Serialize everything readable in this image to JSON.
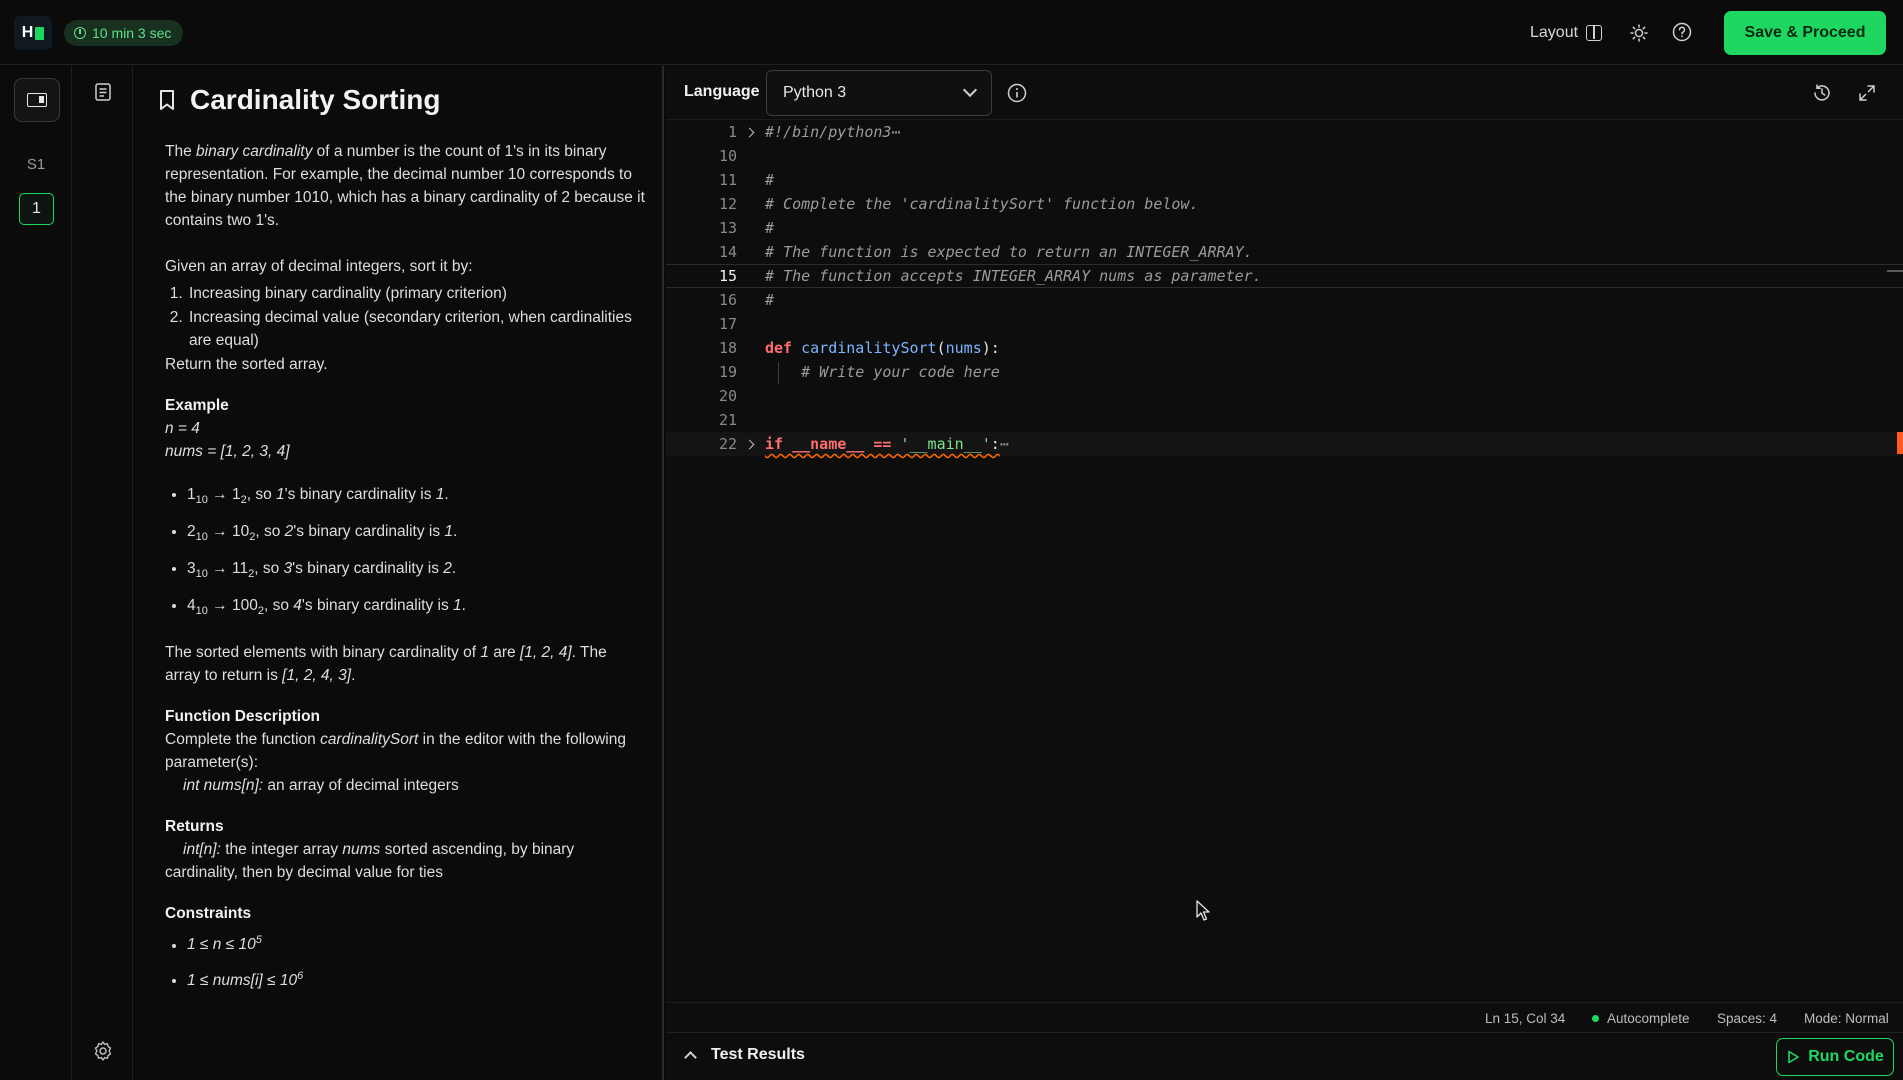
{
  "header": {
    "logo": "H",
    "timer": "10 min 3 sec",
    "layout_label": "Layout",
    "save_label": "Save & Proceed"
  },
  "rail": {
    "section_label": "S1",
    "question_number": "1"
  },
  "problem": {
    "title": "Cardinality Sorting",
    "intro": {
      "p1a": "The ",
      "p1b": "binary cardinality",
      "p1c": " of a number is the count of 1's in its binary representation. For example, the decimal number 10 corresponds to the binary number 1010, which has a binary cardinality of 2 because it contains two 1's."
    },
    "given": "Given an array of decimal integers, sort it by:",
    "criteria": [
      "Increasing binary cardinality (primary criterion)",
      "Increasing decimal value (secondary criterion, when cardinalities are equal)"
    ],
    "return_line": "Return the sorted array.",
    "example_heading": "Example",
    "example_n": "n = 4",
    "example_nums": "nums = [1, 2, 3, 4]",
    "bullets": [
      {
        "a": "1",
        "b": "1",
        "c": ", so ",
        "d": "1",
        "e": "'s binary cardinality is ",
        "f": "1",
        "g": "."
      },
      {
        "a": "2",
        "b": "10",
        "c": ", so ",
        "d": "2",
        "e": "'s binary cardinality is ",
        "f": "1",
        "g": "."
      },
      {
        "a": "3",
        "b": "11",
        "c": ", so ",
        "d": "3",
        "e": "'s binary cardinality is ",
        "f": "2",
        "g": "."
      },
      {
        "a": "4",
        "b": "100",
        "c": ", so ",
        "d": "4",
        "e": "'s binary cardinality is ",
        "f": "1",
        "g": "."
      }
    ],
    "sub10": "10",
    "sub2": "2",
    "arrow": " → ",
    "sorted_a": "The sorted elements with binary cardinality of ",
    "sorted_b": "1",
    "sorted_c": " are ",
    "sorted_d": "[1, 2, 4]",
    "sorted_e": ". The array to return is ",
    "sorted_f": "[1, 2, 4, 3]",
    "sorted_g": ".",
    "func_heading": "Function Description",
    "func_a": "Complete the function ",
    "func_b": "cardinalitySort",
    "func_c": " in the editor with the following parameter(s):",
    "param_a": "int nums[n]:",
    "param_b": "  an array of decimal integers",
    "returns_heading": "Returns",
    "returns_a": "int[n]:",
    "returns_b": " the integer array ",
    "returns_c": "nums",
    "returns_d": " sorted ascending, by binary cardinality, then by decimal value for ties",
    "constraints_heading": "Constraints",
    "c1a": "1 ≤ n ≤ 10",
    "c1b": "5",
    "c2a": "1 ≤ nums[i] ≤ 10",
    "c2b": "6"
  },
  "editor": {
    "language_label": "Language",
    "language_value": "Python 3",
    "lines": [
      {
        "n": "1",
        "text": "#!/bin/python3"
      },
      {
        "n": "10",
        "text": ""
      },
      {
        "n": "11",
        "text": "#"
      },
      {
        "n": "12",
        "text": "# Complete the 'cardinalitySort' function below."
      },
      {
        "n": "13",
        "text": "#"
      },
      {
        "n": "14",
        "text": "# The function is expected to return an INTEGER_ARRAY."
      },
      {
        "n": "15",
        "text": "# The function accepts INTEGER_ARRAY nums as parameter."
      },
      {
        "n": "16",
        "text": "#"
      },
      {
        "n": "17",
        "text": ""
      },
      {
        "n": "18",
        "kw": "def",
        "fn": "cardinalitySort",
        "p1": "(",
        "param": "nums",
        "p2": "):"
      },
      {
        "n": "19",
        "text": "    # Write your code here"
      },
      {
        "n": "20",
        "text": ""
      },
      {
        "n": "21",
        "text": ""
      },
      {
        "n": "22",
        "kw": "if",
        "mid": " __name__ == ",
        "str": "'__main__'",
        "end": ":"
      }
    ],
    "ellipsis": "⋯",
    "status": {
      "position": "Ln 15, Col 34",
      "autocomplete": "Autocomplete",
      "spaces": "Spaces: 4",
      "mode": "Mode: Normal"
    },
    "test_results_label": "Test Results",
    "run_label": "Run Code"
  },
  "colors": {
    "accent": "#1ed760",
    "keyword": "#ff6e6e",
    "function": "#7cb4ff",
    "string": "#7be38a",
    "error_marker": "#ff5a1f"
  }
}
